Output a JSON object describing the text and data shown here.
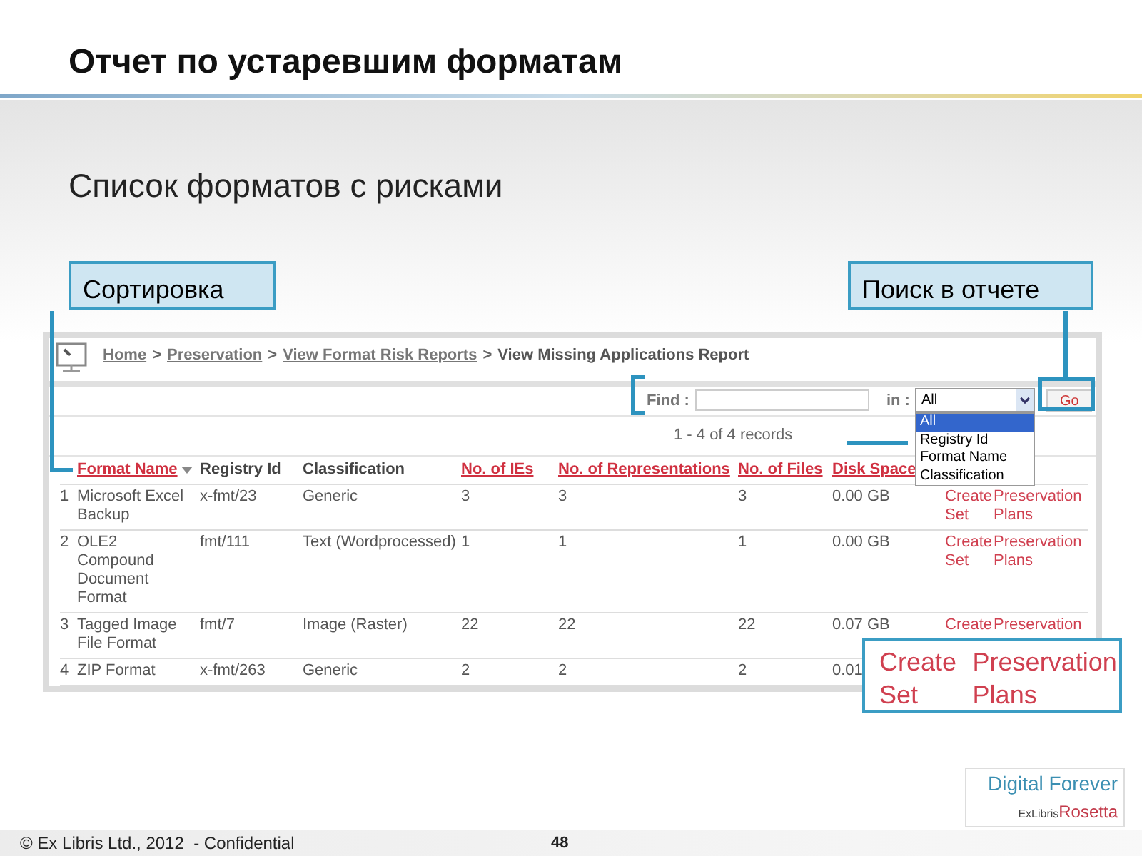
{
  "slide": {
    "title": "Отчет по устаревшим форматам",
    "subtitle": "Список форматов с рисками",
    "callouts": [
      "Сортировка",
      "Поиск в отчете"
    ],
    "app": {
      "breadcrumb": [
        {
          "kind": "link",
          "text": "Home"
        },
        {
          "kind": "separator",
          "text": ">"
        },
        {
          "kind": "link",
          "text": "Preservation"
        },
        {
          "kind": "separator",
          "text": ">"
        },
        {
          "kind": "link",
          "text": "View Format Risk Reports"
        },
        {
          "kind": "separator",
          "text": ">"
        },
        {
          "kind": "current",
          "text": "View Missing Applications Report"
        }
      ],
      "find": {
        "label": "Find :",
        "in_label": "in :",
        "select_value": "All",
        "button": "Go",
        "options": [
          {
            "label": "All",
            "selected": true
          },
          {
            "label": "Registry Id",
            "selected": false
          },
          {
            "label": "Format Name",
            "selected": false
          },
          {
            "label": "Classification",
            "selected": false
          }
        ]
      },
      "records": "1 - 4 of 4 records",
      "columns": [
        {
          "label": "Format Name",
          "sortable": true,
          "sorted": true
        },
        {
          "label": "Registry Id",
          "sortable": false,
          "sorted": false
        },
        {
          "label": "Classification",
          "sortable": false,
          "sorted": false
        },
        {
          "label": "No. of IEs",
          "sortable": true,
          "sorted": false
        },
        {
          "label": "No. of Representations",
          "sortable": true,
          "sorted": false
        },
        {
          "label": "No. of Files",
          "sortable": true,
          "sorted": false
        },
        {
          "label": "Disk Space",
          "sortable": true,
          "sorted": false
        }
      ],
      "rows": [
        {
          "number": "1",
          "cells": [
            "Microsoft Excel Backup",
            "x-fmt/23",
            "Generic",
            "3",
            "3",
            "3",
            "0.00 GB"
          ],
          "actions": [
            "Create Set",
            "Preservation Plans"
          ]
        },
        {
          "number": "2",
          "cells": [
            "OLE2 Compound Document Format",
            "fmt/111",
            "Text (Wordprocessed)",
            "1",
            "1",
            "1",
            "0.00 GB"
          ],
          "actions": [
            "Create Set",
            "Preservation Plans"
          ]
        },
        {
          "number": "3",
          "cells": [
            "Tagged Image File Format",
            "fmt/7",
            "Image (Raster)",
            "22",
            "22",
            "22",
            "0.07 GB"
          ],
          "actions": [
            "Create",
            "Preservation"
          ]
        },
        {
          "number": "4",
          "cells": [
            "ZIP Format",
            "x-fmt/263",
            "Generic",
            "2",
            "2",
            "2",
            "0.01"
          ],
          "actions": []
        }
      ]
    },
    "zoom_callout": [
      "Create Set",
      "Preservation Plans"
    ],
    "logo": {
      "line_1": "Digital Forever",
      "brand": "ExLibris",
      "product": "Rosetta"
    },
    "footer": {
      "copyright": "© Ex Libris Ltd., 2012  - Confidential",
      "page": "48"
    }
  }
}
